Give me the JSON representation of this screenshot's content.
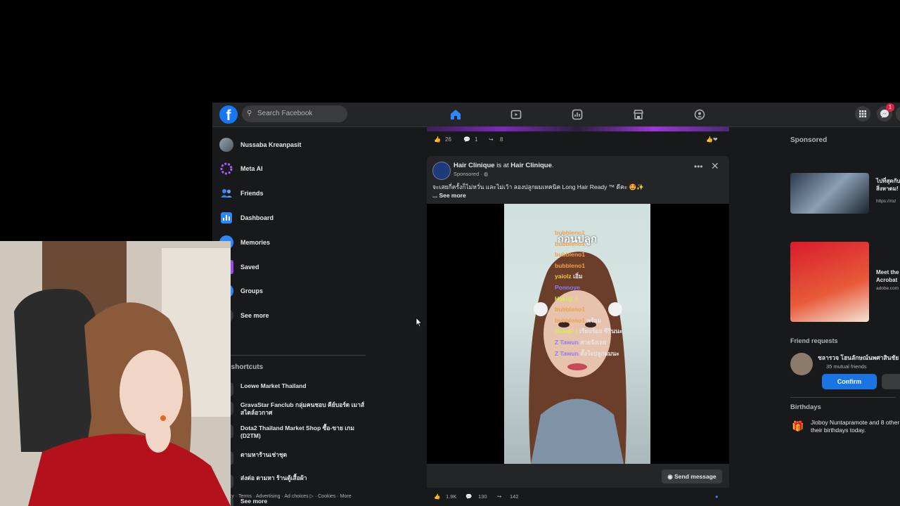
{
  "topbar": {
    "logo": "f",
    "search_placeholder": "Search Facebook",
    "messenger_badge": "1",
    "nav_icons": [
      "home-icon",
      "video-icon",
      "feeds-icon",
      "marketplace-icon",
      "groups-icon"
    ],
    "accent": "#1877f2"
  },
  "sidebar": {
    "items": [
      {
        "label": "Nussaba Kreanpasit",
        "icon": "profile-avatar"
      },
      {
        "label": "Meta AI",
        "icon": "meta-ai-icon"
      },
      {
        "label": "Friends",
        "icon": "friends-icon"
      },
      {
        "label": "Dashboard",
        "icon": "dashboard-icon"
      },
      {
        "label": "Memories",
        "icon": "clock-icon"
      },
      {
        "label": "Saved",
        "icon": "bookmark-icon"
      },
      {
        "label": "Groups",
        "icon": "groups-icon"
      },
      {
        "label": "See more",
        "icon": "chevron-down-icon"
      }
    ],
    "shortcuts_heading": "r shortcuts",
    "shortcuts": [
      {
        "label": "Loewe Market Thailand"
      },
      {
        "label": "GravaStar Fanclub กลุ่มคนชอบ คีย์บอร์ด เมาส์ สไตล์อวกาศ"
      },
      {
        "label": "Dota2 Thailand Market Shop ซื้อ-ขาย เกม (D2TM)"
      },
      {
        "label": "ตามหาร้านเช่าชุด"
      },
      {
        "label": "ส่งต่อ ตามหา ร้านตู้เสื้อผ้า"
      },
      {
        "label": "See more"
      }
    ],
    "footer": "acy · Terms · Advertising · Ad choices ▷ · Cookies · More"
  },
  "feed": {
    "prev_post": {
      "likes": "26",
      "comments": "1",
      "shares": "8"
    },
    "post": {
      "page_name": "Hair Clinique",
      "is_at": " is at ",
      "location": "Hair Clinique",
      "sponsored": "Sponsored · ",
      "text": "จะเสยกี่ครั้งก็ไม่หวั่น และไม่เว้า ลองปลูกผมเทคนิค Long Hair Ready ™ ดีคะ 🤩✨",
      "see_more": "... See more",
      "video_caption": "ก่อนปลูก",
      "send_message": "Send message",
      "likes": "1.9K",
      "comments": "130",
      "shares": "142"
    }
  },
  "right": {
    "sponsored_heading": "Sponsored",
    "ads": [
      {
        "headline": "ไปที่สุดกับสิ่งหาดม!",
        "url": "https://roz"
      },
      {
        "headline": "Meet the Acrobat",
        "url": "adobe.com"
      }
    ],
    "friend_requests_heading": "Friend requests",
    "friend_request": {
      "name": "ชลารวจ โฮนลักษณ์นพศาสินชัย",
      "mutual": "35 mutual friends",
      "confirm": "Confirm"
    },
    "birthdays_heading": "Birthdays",
    "birthday_text": "Jioboy Nuntapramote and 8 other their birthdays today."
  },
  "chat_overlay": [
    {
      "user": "bubbleno1",
      "msg": "",
      "color": "#f0a04b"
    },
    {
      "user": "bubbleno1",
      "msg": "",
      "color": "#f0a04b"
    },
    {
      "user": "bubbleno1",
      "msg": "",
      "color": "#f0a04b"
    },
    {
      "user": "bubbleno1",
      "msg": "",
      "color": "#f0a04b"
    },
    {
      "user": "yaiolz",
      "msg": "เอิ่ม",
      "color": "#f0c24b"
    },
    {
      "user": "Ponnoye",
      "msg": "",
      "color": "#8a7bff"
    },
    {
      "user": "Hakuji_l",
      "msg": "",
      "color": "#d8f04b"
    },
    {
      "user": "bubbleno1",
      "msg": "",
      "color": "#f0a04b"
    },
    {
      "user": "bubbleno1",
      "msg": "พร้อม",
      "color": "#f0a04b"
    },
    {
      "user": "Hakuji_l",
      "msg": "เรียบร้อย ซีรีนนะ",
      "color": "#d8f04b"
    },
    {
      "user": "Z Tawun",
      "msg": "สวยจังเลย",
      "color": "#8a7bff"
    },
    {
      "user": "Z Tawun",
      "msg": "ตั้งใจปลูกผมนะ",
      "color": "#8a7bff"
    }
  ]
}
